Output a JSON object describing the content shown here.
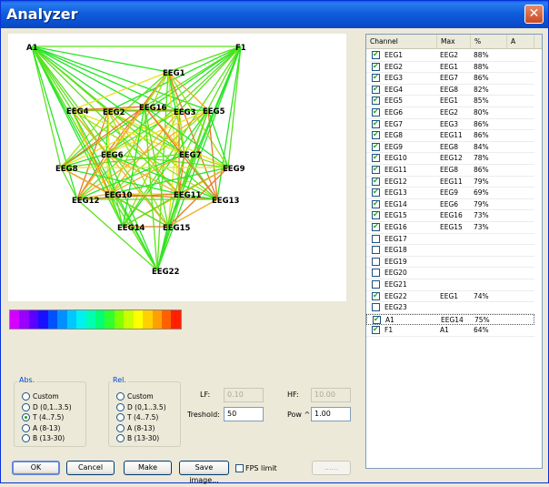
{
  "window": {
    "title": "Analyzer",
    "close_glyph": "✕"
  },
  "graph": {
    "nodes": [
      {
        "id": "A1",
        "label": "A1"
      },
      {
        "id": "F1",
        "label": "F1"
      },
      {
        "id": "EEG1",
        "label": "EEG1"
      },
      {
        "id": "EEG2",
        "label": "EEG2"
      },
      {
        "id": "EEG3",
        "label": "EEG3"
      },
      {
        "id": "EEG4",
        "label": "EEG4"
      },
      {
        "id": "EEG5",
        "label": "EEG5"
      },
      {
        "id": "EEG6",
        "label": "EEG6"
      },
      {
        "id": "EEG7",
        "label": "EEG7"
      },
      {
        "id": "EEG8",
        "label": "EEG8"
      },
      {
        "id": "EEG9",
        "label": "EEG9"
      },
      {
        "id": "EEG10",
        "label": "EEG10"
      },
      {
        "id": "EEG11",
        "label": "EEG11"
      },
      {
        "id": "EEG12",
        "label": "EEG12"
      },
      {
        "id": "EEG13",
        "label": "EEG13"
      },
      {
        "id": "EEG14",
        "label": "EEG14"
      },
      {
        "id": "EEG15",
        "label": "EEG15"
      },
      {
        "id": "EEG16",
        "label": "EEG16"
      },
      {
        "id": "EEG22",
        "label": "EEG22"
      }
    ]
  },
  "colorbar": [
    "#d400ff",
    "#9a00ff",
    "#5a00ff",
    "#1a10ff",
    "#0050ff",
    "#0090ff",
    "#00c8ff",
    "#00f0f0",
    "#00ffb0",
    "#00ff70",
    "#30ff30",
    "#80ff00",
    "#c8ff00",
    "#ffff00",
    "#ffd000",
    "#ffa000",
    "#ff6000",
    "#ff2000"
  ],
  "table": {
    "headers": [
      "Channel",
      "Max",
      "%",
      "A"
    ],
    "rows": [
      {
        "checked": true,
        "channel": "EEG1",
        "max": "EEG2",
        "pct": "88%"
      },
      {
        "checked": true,
        "channel": "EEG2",
        "max": "EEG1",
        "pct": "88%"
      },
      {
        "checked": true,
        "channel": "EEG3",
        "max": "EEG7",
        "pct": "86%"
      },
      {
        "checked": true,
        "channel": "EEG4",
        "max": "EEG8",
        "pct": "82%"
      },
      {
        "checked": true,
        "channel": "EEG5",
        "max": "EEG1",
        "pct": "85%"
      },
      {
        "checked": true,
        "channel": "EEG6",
        "max": "EEG2",
        "pct": "80%"
      },
      {
        "checked": true,
        "channel": "EEG7",
        "max": "EEG3",
        "pct": "86%"
      },
      {
        "checked": true,
        "channel": "EEG8",
        "max": "EEG11",
        "pct": "86%"
      },
      {
        "checked": true,
        "channel": "EEG9",
        "max": "EEG8",
        "pct": "84%"
      },
      {
        "checked": true,
        "channel": "EEG10",
        "max": "EEG12",
        "pct": "78%"
      },
      {
        "checked": true,
        "channel": "EEG11",
        "max": "EEG8",
        "pct": "86%"
      },
      {
        "checked": true,
        "channel": "EEG12",
        "max": "EEG11",
        "pct": "79%"
      },
      {
        "checked": true,
        "channel": "EEG13",
        "max": "EEG9",
        "pct": "69%"
      },
      {
        "checked": true,
        "channel": "EEG14",
        "max": "EEG6",
        "pct": "79%"
      },
      {
        "checked": true,
        "channel": "EEG15",
        "max": "EEG16",
        "pct": "73%"
      },
      {
        "checked": true,
        "channel": "EEG16",
        "max": "EEG15",
        "pct": "73%"
      },
      {
        "checked": false,
        "channel": "EEG17",
        "max": "",
        "pct": ""
      },
      {
        "checked": false,
        "channel": "EEG18",
        "max": "",
        "pct": ""
      },
      {
        "checked": false,
        "channel": "EEG19",
        "max": "",
        "pct": ""
      },
      {
        "checked": false,
        "channel": "EEG20",
        "max": "",
        "pct": ""
      },
      {
        "checked": false,
        "channel": "EEG21",
        "max": "",
        "pct": ""
      },
      {
        "checked": true,
        "channel": "EEG22",
        "max": "EEG1",
        "pct": "74%"
      },
      {
        "checked": false,
        "channel": "EEG23",
        "max": "",
        "pct": ""
      },
      {
        "checked": true,
        "channel": "A1",
        "max": "EEG14",
        "pct": "75%"
      },
      {
        "checked": true,
        "channel": "F1",
        "max": "A1",
        "pct": "64%"
      }
    ]
  },
  "abs": {
    "label": "Abs.",
    "options": [
      "Custom",
      "D (0,1..3.5)",
      "T (4..7.5)",
      "A (8-13)",
      "B (13-30)"
    ],
    "selected": 2
  },
  "rel": {
    "label": "Rel.",
    "options": [
      "Custom",
      "D (0,1..3.5)",
      "T (4..7.5)",
      "A (8-13)",
      "B (13-30)"
    ],
    "selected": -1
  },
  "params": {
    "lf_label": "LF:",
    "lf_value": "0.10",
    "hf_label": "HF:",
    "hf_value": "10.00",
    "threshold_label": "Treshold:",
    "threshold_value": "50",
    "pow_label": "Pow ^",
    "pow_value": "1.00"
  },
  "buttons": {
    "ok": "OK",
    "cancel": "Cancel",
    "make": "Make",
    "save_image": "Save image...",
    "fps_limit": "FPS limit",
    "disabled_btn": "......"
  }
}
